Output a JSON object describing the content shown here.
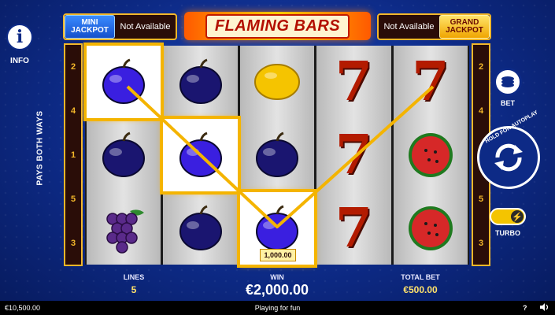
{
  "header": {
    "mini_jackpot_line1": "MINI",
    "mini_jackpot_line2": "JACKPOT",
    "mini_status": "Not Available",
    "logo_text": "FLAMING BARS",
    "grand_jackpot_line1": "GRAND",
    "grand_jackpot_line2": "JACKPOT",
    "grand_status": "Not Available"
  },
  "left_controls": {
    "info_label": "INFO",
    "info_icon": "i"
  },
  "paylines": {
    "left": [
      "2",
      "4",
      "1",
      "5",
      "3"
    ],
    "right": [
      "2",
      "4",
      "1",
      "5",
      "3"
    ],
    "pays_both_ways": "PAYS BOTH WAYS"
  },
  "reels": [
    [
      "plum-win",
      "plum",
      "grapes"
    ],
    [
      "plum",
      "plum-win",
      "plum"
    ],
    [
      "lemon",
      "plum",
      "plum-win"
    ],
    [
      "seven",
      "seven",
      "seven"
    ],
    [
      "seven",
      "watermelon",
      "watermelon"
    ]
  ],
  "win_tag": "1,000.00",
  "right_controls": {
    "bet_label": "BET",
    "autoplay_hint": "HOLD FOR AUTOPLAY",
    "turbo_label": "TURBO"
  },
  "stats": {
    "lines_label": "LINES",
    "lines_value": "5",
    "win_label": "WIN",
    "win_value": "€2,000.00",
    "total_bet_label": "TOTAL BET",
    "total_bet_value": "€500.00"
  },
  "footer": {
    "balance": "€10,500.00",
    "mode": "Playing for fun",
    "help": "?"
  },
  "colors": {
    "background": "#0d2a86",
    "frame_gold": "#f3b72a",
    "win_highlight": "#f4b400",
    "plum": "#2a1fb5",
    "seven": "#b31b00"
  }
}
